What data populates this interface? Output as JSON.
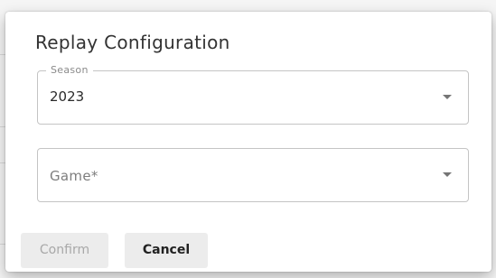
{
  "dialog": {
    "title": "Replay Configuration"
  },
  "season_field": {
    "label": "Season",
    "value": "2023",
    "icon": "chevron-down-icon"
  },
  "game_field": {
    "placeholder": "Game*",
    "value": "",
    "icon": "chevron-down-icon"
  },
  "actions": {
    "confirm_label": "Confirm",
    "confirm_disabled": true,
    "cancel_label": "Cancel"
  },
  "colors": {
    "backdrop": "#f5f5f5",
    "field_border": "#c4c4c4",
    "button_background": "#ececec",
    "disabled_text": "#a8a8a8",
    "title_text": "#333333"
  }
}
